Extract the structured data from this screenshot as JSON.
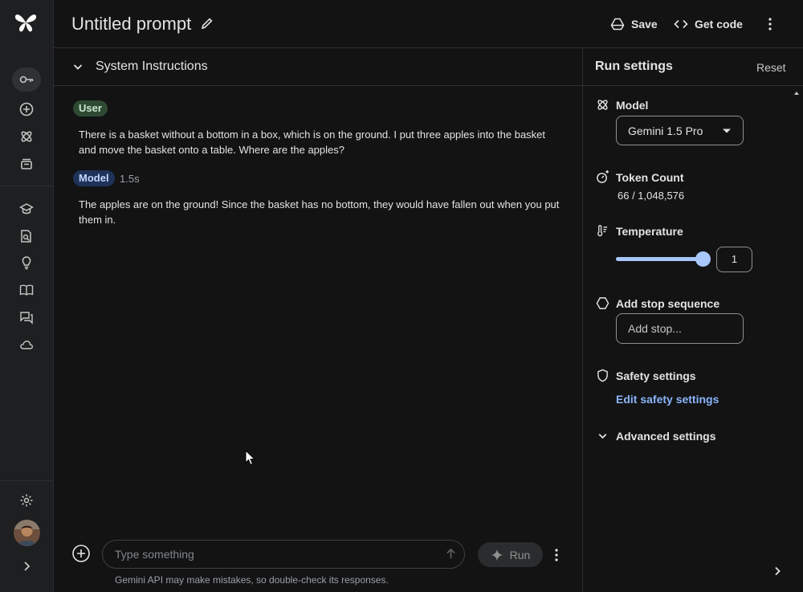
{
  "header": {
    "title": "Untitled prompt",
    "save_label": "Save",
    "get_code_label": "Get code"
  },
  "rail": {
    "items": [
      "key-icon",
      "add-circle-icon",
      "model-gallery-icon",
      "library-icon",
      "school-icon",
      "document-search-icon",
      "lightbulb-icon",
      "book-icon",
      "forum-icon",
      "cloud-icon",
      "settings-icon"
    ]
  },
  "system_instructions": {
    "label": "System Instructions"
  },
  "chat": {
    "messages": [
      {
        "role": "User",
        "duration": "",
        "text": "There is a basket without a bottom in a box, which is on the ground. I put three apples into the basket and move the basket onto a table. Where are the apples?"
      },
      {
        "role": "Model",
        "duration": "1.5s",
        "text": "The apples are on the ground! Since the basket has no bottom, they would have fallen out when you put them in."
      }
    ]
  },
  "input": {
    "placeholder": "Type something",
    "run_label": "Run",
    "disclaimer": "Gemini API may make mistakes, so double-check its responses."
  },
  "run_settings": {
    "title": "Run settings",
    "reset_label": "Reset",
    "model_label": "Model",
    "model_value": "Gemini 1.5 Pro",
    "token_label": "Token Count",
    "token_value": "66 / 1,048,576",
    "temperature_label": "Temperature",
    "temperature_value": "1",
    "temperature_fraction": 1.0,
    "stop_label": "Add stop sequence",
    "stop_placeholder": "Add stop...",
    "safety_label": "Safety settings",
    "safety_link": "Edit safety settings",
    "advanced_label": "Advanced settings"
  },
  "colors": {
    "background": "#131314",
    "rail": "#1e1f20",
    "accent": "#a8c7fa",
    "link": "#8ab4f8",
    "user_badge": "#2e4a33",
    "model_badge": "#1f3259"
  }
}
